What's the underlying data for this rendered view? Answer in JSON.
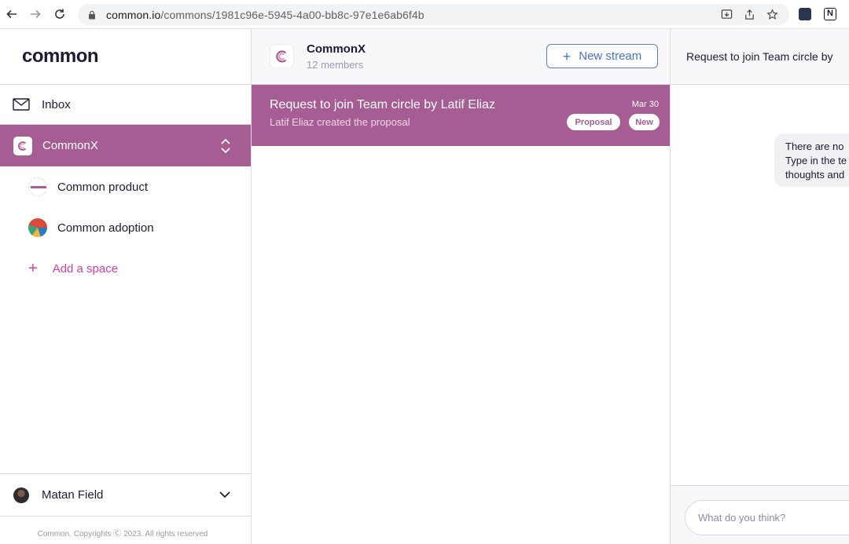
{
  "browser": {
    "url_host": "common.io",
    "url_path": "/commons/1981c96e-5945-4a00-bb8c-97e1e6ab6f4b"
  },
  "sidebar": {
    "logo": "common",
    "inbox_label": "Inbox",
    "active_common": "CommonX",
    "spaces": [
      {
        "label": "Common product"
      },
      {
        "label": "Common adoption"
      }
    ],
    "add_space_label": "Add a space",
    "user_name": "Matan Field",
    "footer": "Common. Copyrights Ⓒ 2023. All rights reserved"
  },
  "stream": {
    "common_name": "CommonX",
    "members": "12 members",
    "new_stream_label": "New stream",
    "items": [
      {
        "title": "Request to join Team circle by Latif Eliaz",
        "subtitle": "Latif Eliaz created the proposal",
        "date": "Mar 30",
        "badge_type": "Proposal",
        "badge_new": "New"
      }
    ]
  },
  "chat": {
    "header_title": "Request to join Team circle by",
    "bubble_lines": [
      "There are no",
      "Type in the te",
      "thoughts and"
    ],
    "composer_placeholder": "What do you think?"
  },
  "colors": {
    "accent": "#a65d93",
    "link_blue": "#4b6fd6",
    "add_pink": "#d63ba7"
  }
}
